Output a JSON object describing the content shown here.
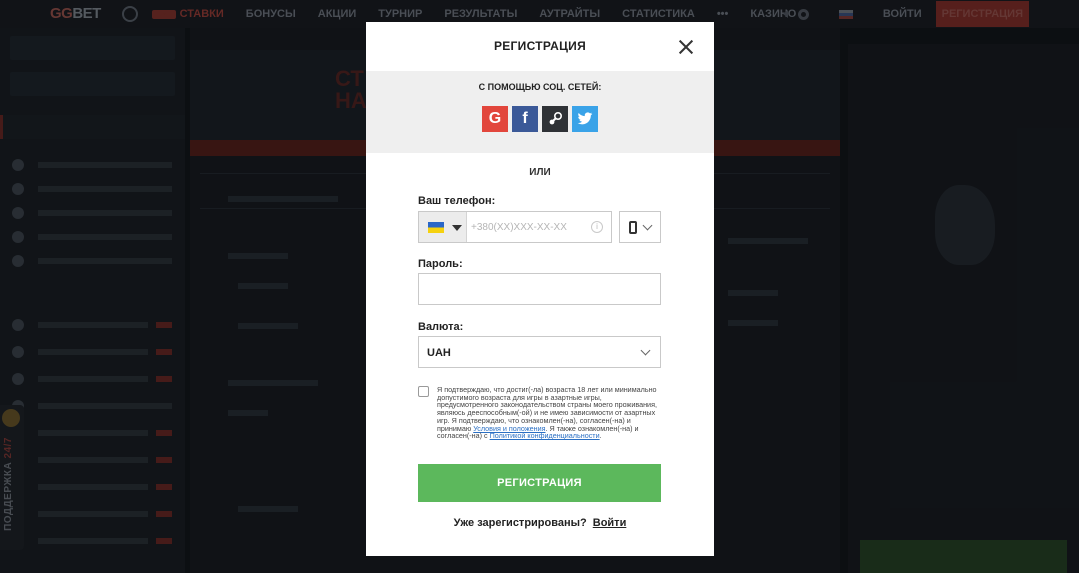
{
  "topbar": {
    "logo_gg": "GG",
    "logo_bet": "BET",
    "nav": [
      {
        "label": "СТАВКИ",
        "active": true
      },
      {
        "label": "БОНУСЫ"
      },
      {
        "label": "АКЦИИ"
      },
      {
        "label": "ТУРНИР"
      },
      {
        "label": "РЕЗУЛЬТАТЫ"
      },
      {
        "label": "АУТРАЙТЫ"
      },
      {
        "label": "СТАТИСТИКА"
      },
      {
        "label": "•••"
      },
      {
        "label": "КАЗИНО"
      }
    ],
    "live_badge": "LIVE",
    "login": "ВОЙТИ",
    "register": "РЕГИСТРАЦИЯ"
  },
  "background": {
    "banner_text_line1": "СТ",
    "banner_text_line2": "НА"
  },
  "support": {
    "label_main": "ПОДДЕРЖКА",
    "label_hours": "24/7"
  },
  "modal": {
    "title": "РЕГИСТРАЦИЯ",
    "social_title": "С ПОМОЩЬЮ СОЦ. СЕТЕЙ:",
    "social": [
      {
        "name": "google",
        "glyph": "G"
      },
      {
        "name": "facebook",
        "glyph": "f"
      },
      {
        "name": "steam",
        "glyph": "⚙"
      },
      {
        "name": "twitter",
        "glyph": "🐦"
      }
    ],
    "or": "ИЛИ",
    "phone_label": "Ваш телефон:",
    "phone_placeholder": "+380(XX)XXX-XX-XX",
    "password_label": "Пароль:",
    "currency_label": "Валюта:",
    "currency_value": "UAH",
    "terms_text": "Я подтверждаю, что достиг(-ла) возраста 18 лет или минимально допустимого возраста для игры в азартные игры, предусмотренного законодательством страны моего проживания, являюсь дееспособным(-ой) и не имею зависимости от азартных игр. Я подтверждаю, что ознакомлен(-на), согласен(-на) и принимаю",
    "terms_link1": "Условия и положения",
    "terms_mid": ". Я также ознакомлен(-на) и согласен(-на) с",
    "terms_link2": "Политикой конфиденциальности",
    "terms_end": ".",
    "submit": "РЕГИСТРАЦИЯ",
    "already_text": "Уже зарегистрированы?",
    "login_link": "Войти"
  }
}
